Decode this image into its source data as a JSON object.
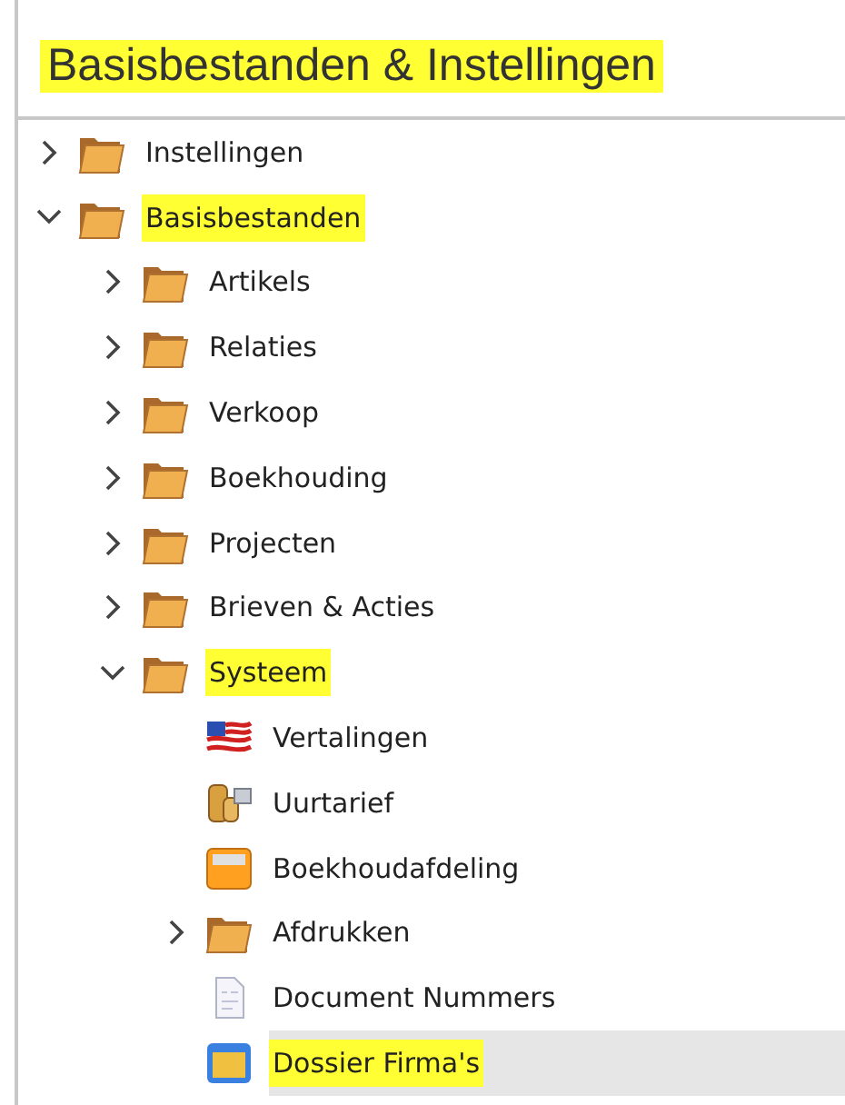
{
  "panel": {
    "title": "Basisbestanden & Instellingen",
    "title_highlighted": true
  },
  "tree": [
    {
      "label": "Instellingen",
      "kind": "folder",
      "expanded": false,
      "selected": false,
      "highlighted": false
    },
    {
      "label": "Basisbestanden",
      "kind": "folder",
      "expanded": true,
      "selected": false,
      "highlighted": true,
      "children": [
        {
          "label": "Artikels",
          "kind": "folder",
          "expanded": false,
          "selected": false,
          "highlighted": false
        },
        {
          "label": "Relaties",
          "kind": "folder",
          "expanded": false,
          "selected": false,
          "highlighted": false
        },
        {
          "label": "Verkoop",
          "kind": "folder",
          "expanded": false,
          "selected": false,
          "highlighted": false
        },
        {
          "label": "Boekhouding",
          "kind": "folder",
          "expanded": false,
          "selected": false,
          "highlighted": false
        },
        {
          "label": "Projecten",
          "kind": "folder",
          "expanded": false,
          "selected": false,
          "highlighted": false
        },
        {
          "label": "Brieven & Acties",
          "kind": "folder",
          "expanded": false,
          "selected": false,
          "highlighted": false
        },
        {
          "label": "Systeem",
          "kind": "folder",
          "expanded": true,
          "selected": false,
          "highlighted": true,
          "children": [
            {
              "label": "Vertalingen",
              "kind": "flag",
              "selected": false,
              "highlighted": false
            },
            {
              "label": "Uurtarief",
              "kind": "coins",
              "selected": false,
              "highlighted": false
            },
            {
              "label": "Boekhoudafdeling",
              "kind": "drawer",
              "selected": false,
              "highlighted": false
            },
            {
              "label": "Afdrukken",
              "kind": "folder",
              "expanded": false,
              "selected": false,
              "highlighted": false
            },
            {
              "label": "Document Nummers",
              "kind": "document",
              "selected": false,
              "highlighted": false
            },
            {
              "label": "Dossier Firma's",
              "kind": "window",
              "selected": true,
              "highlighted": true
            }
          ]
        }
      ]
    }
  ]
}
